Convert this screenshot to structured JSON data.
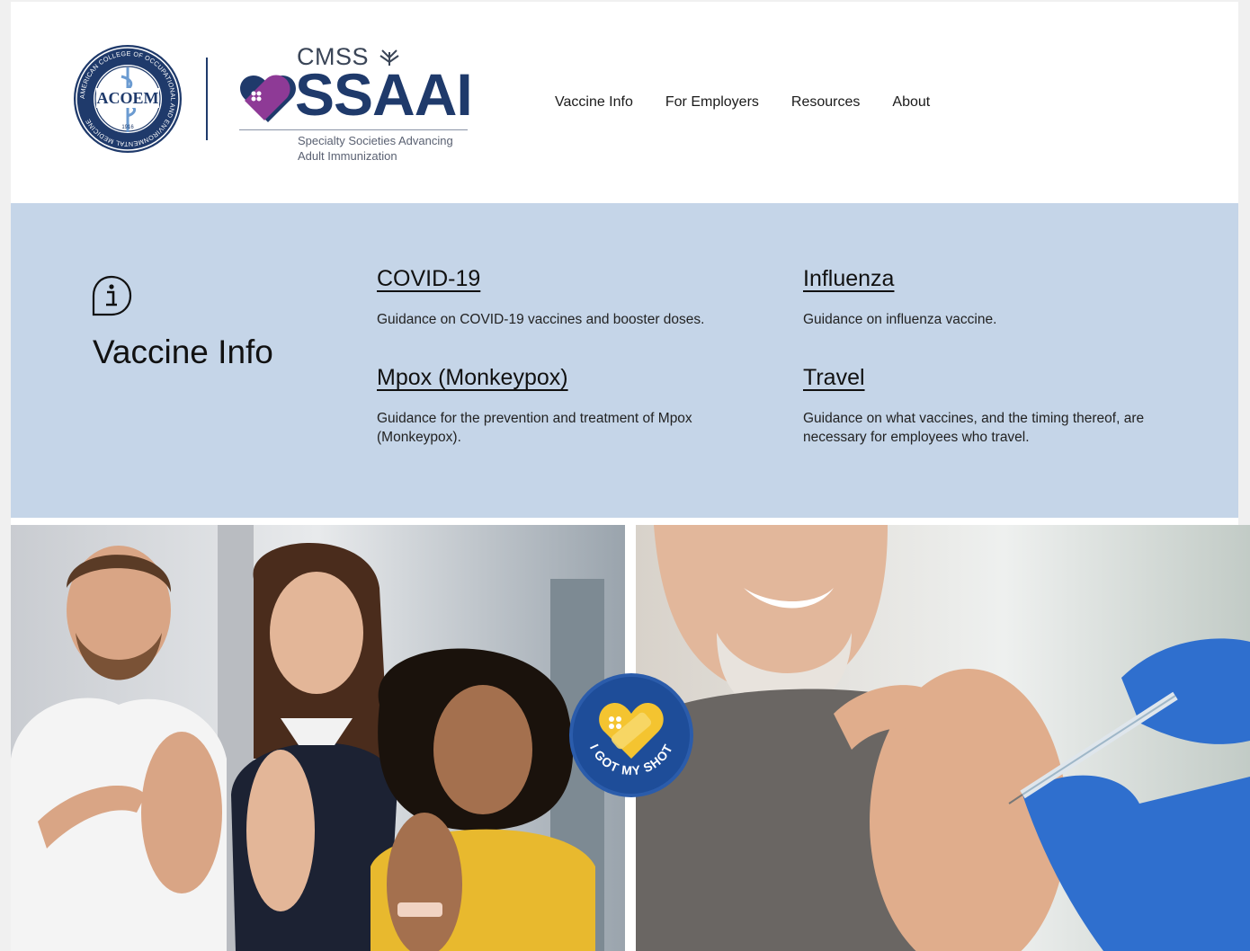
{
  "header": {
    "acoem_logo": {
      "name": "acoem-seal",
      "center_text": "ACOEM",
      "ring_text": "AMERICAN COLLEGE OF OCCUPATIONAL AND ENVIRONMENTAL MEDICINE",
      "year": "1916"
    },
    "ssaai_logo": {
      "org": "CMSS",
      "acronym": "SSAAI",
      "tagline_line1": "Specialty Societies Advancing",
      "tagline_line2": "Adult Immunization"
    },
    "nav": [
      {
        "label": "Vaccine Info"
      },
      {
        "label": "For Employers"
      },
      {
        "label": "Resources"
      },
      {
        "label": "About"
      }
    ]
  },
  "vaccine_info": {
    "icon": "info-icon",
    "title": "Vaccine Info",
    "cards": [
      {
        "title": "COVID-19",
        "description": "Guidance on COVID-19 vaccines and booster doses."
      },
      {
        "title": "Influenza",
        "description": "Guidance on influenza vaccine."
      },
      {
        "title": "Mpox (Monkeypox)",
        "description": "Guidance for the prevention and treatment of Mpox (Monkeypox)."
      },
      {
        "title": "Travel",
        "description": "Guidance on what vaccines, and the timing thereof, are necessary for employees who travel."
      }
    ]
  },
  "hero": {
    "badge_text": "I GOT MY SHOT"
  },
  "colors": {
    "band_bg": "#c5d5e8",
    "brand_navy": "#1f3a6b",
    "brand_purple": "#8e3a96",
    "badge_yellow": "#f4c430"
  }
}
